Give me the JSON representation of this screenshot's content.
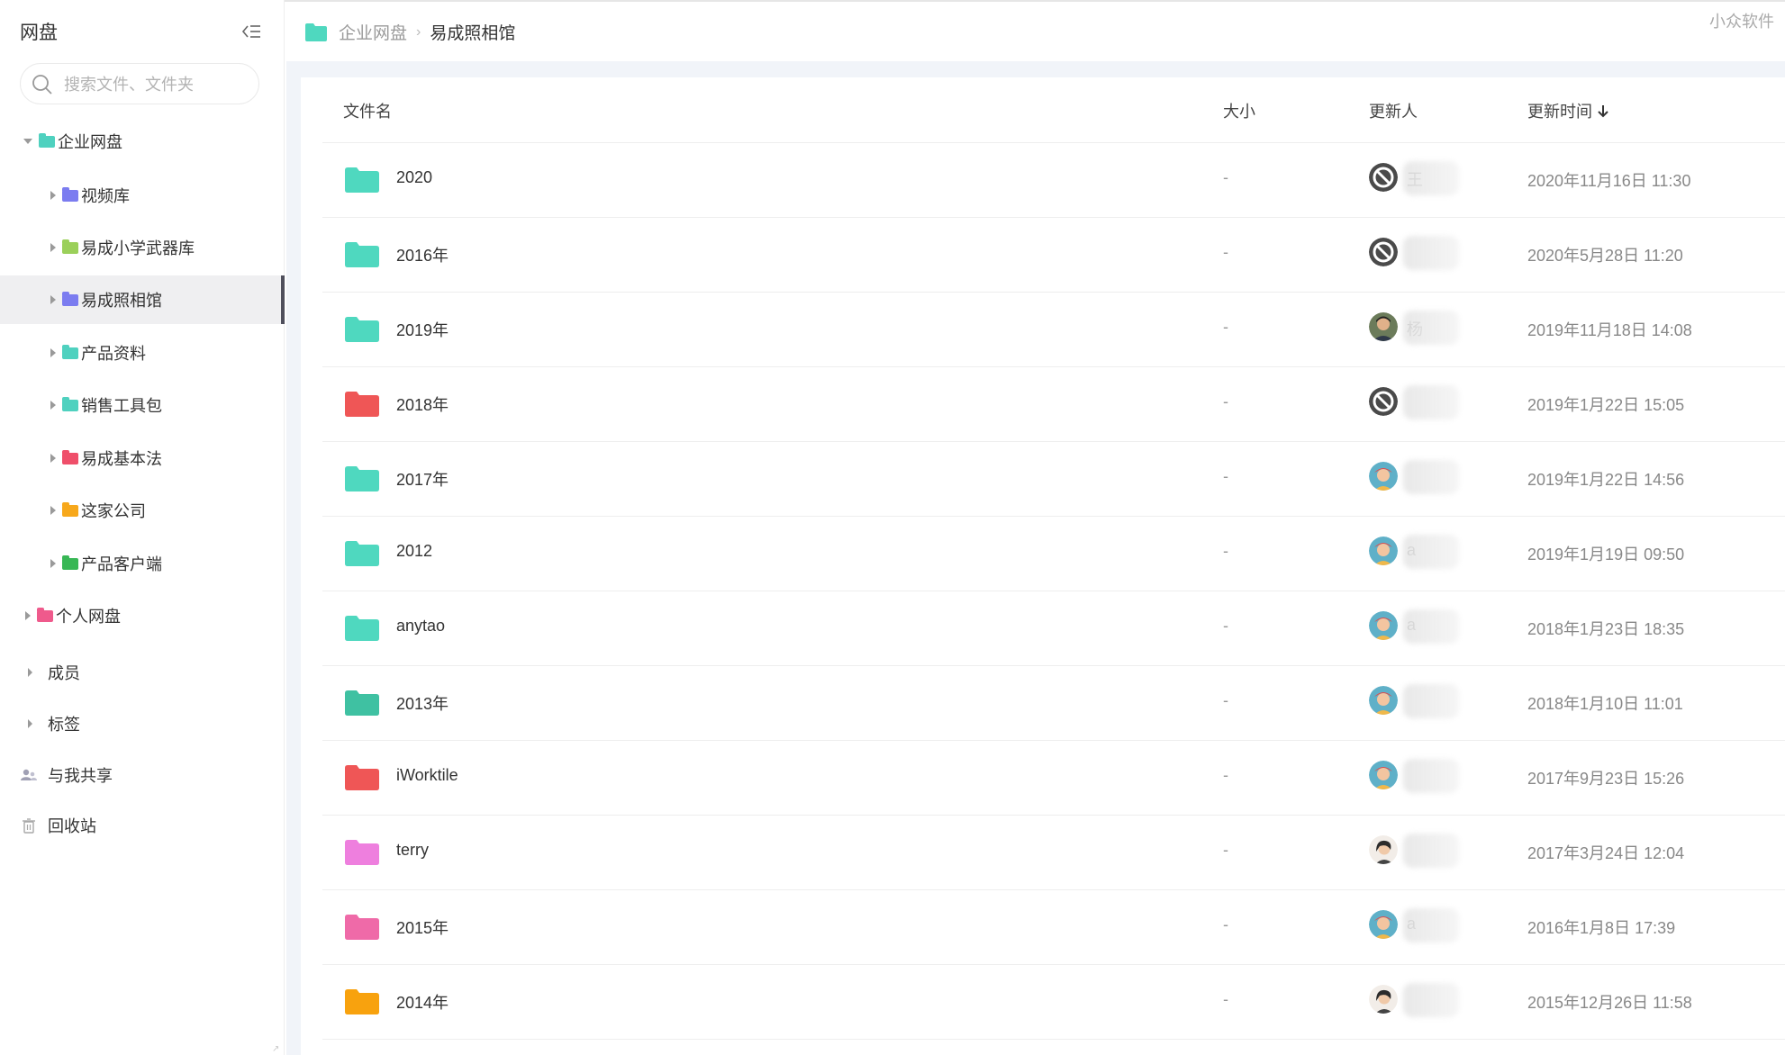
{
  "sidebar": {
    "title": "网盘",
    "search_placeholder": "搜索文件、文件夹",
    "tree": [
      {
        "label": "企业网盘",
        "color": "#4fd1bf",
        "expanded": true
      },
      {
        "label": "视频库",
        "color": "#7b7cf0"
      },
      {
        "label": "易成小学武器库",
        "color": "#9bd05a"
      },
      {
        "label": "易成照相馆",
        "color": "#7b7cf0",
        "selected": true
      },
      {
        "label": "产品资料",
        "color": "#4fd1bf"
      },
      {
        "label": "销售工具包",
        "color": "#4fd1bf"
      },
      {
        "label": "易成基本法",
        "color": "#ef4f6a"
      },
      {
        "label": "这家公司",
        "color": "#f7a81b"
      },
      {
        "label": "产品客户端",
        "color": "#38b755"
      },
      {
        "label": "个人网盘",
        "color": "#ef5a8c"
      }
    ],
    "nav": [
      {
        "label": "成员",
        "icon": "caret-right-icon"
      },
      {
        "label": "标签",
        "icon": "caret-right-icon"
      },
      {
        "label": "与我共享",
        "icon": "shared-users-icon"
      },
      {
        "label": "回收站",
        "icon": "trash-icon"
      }
    ]
  },
  "breadcrumb": {
    "root": "企业网盘",
    "separator": "›",
    "current": "易成照相馆"
  },
  "watermark": "小众软件",
  "table": {
    "columns": {
      "name": "文件名",
      "size": "大小",
      "updater": "更新人",
      "time": "更新时间"
    },
    "sort_indicator": "descending-arrow-icon",
    "rows": [
      {
        "name": "2020",
        "size": "-",
        "updater": "王",
        "avatar": "blocked",
        "time": "2020年11月16日 11:30",
        "color": "#4fd8bf"
      },
      {
        "name": "2016年",
        "size": "-",
        "updater": "",
        "avatar": "blocked",
        "time": "2020年5月28日 11:20",
        "color": "#4fd8bf"
      },
      {
        "name": "2019年",
        "size": "-",
        "updater": "杨",
        "avatar": "photo-man",
        "time": "2019年11月18日 14:08",
        "color": "#4fd8bf"
      },
      {
        "name": "2018年",
        "size": "-",
        "updater": "",
        "avatar": "blocked",
        "time": "2019年1月22日 15:05",
        "color": "#ef5656"
      },
      {
        "name": "2017年",
        "size": "-",
        "updater": "",
        "avatar": "photo-girl",
        "time": "2019年1月22日 14:56",
        "color": "#4fd8bf"
      },
      {
        "name": "2012",
        "size": "-",
        "updater": "a",
        "avatar": "photo-girl",
        "time": "2019年1月19日 09:50",
        "color": "#4fd8bf"
      },
      {
        "name": "anytao",
        "size": "-",
        "updater": "a",
        "avatar": "photo-girl",
        "time": "2018年1月23日 18:35",
        "color": "#4fd8bf"
      },
      {
        "name": "2013年",
        "size": "-",
        "updater": "",
        "avatar": "photo-girl",
        "time": "2018年1月10日 11:01",
        "color": "#3fc1a2"
      },
      {
        "name": "iWorktile",
        "size": "-",
        "updater": "",
        "avatar": "photo-girl",
        "time": "2017年9月23日 15:26",
        "color": "#ef5656"
      },
      {
        "name": "terry",
        "size": "-",
        "updater": "",
        "avatar": "photo-woman",
        "time": "2017年3月24日 12:04",
        "color": "#ee7fde"
      },
      {
        "name": "2015年",
        "size": "-",
        "updater": "a",
        "avatar": "photo-girl",
        "time": "2016年1月8日 17:39",
        "color": "#ef6aa8"
      },
      {
        "name": "2014年",
        "size": "-",
        "updater": "",
        "avatar": "photo-woman",
        "time": "2015年12月26日 11:58",
        "color": "#f8a20e"
      }
    ]
  }
}
